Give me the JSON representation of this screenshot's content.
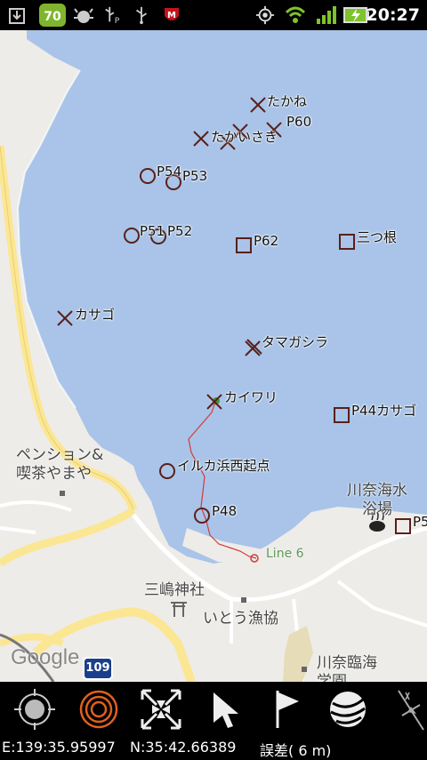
{
  "status_bar": {
    "time": "20:27",
    "badge_count": "70",
    "icons": [
      "download-icon",
      "android-badge-icon",
      "bug-icon",
      "usb-p-icon",
      "usb-icon",
      "mcafee-icon",
      "gps-icon",
      "wifi-icon",
      "signal-icon",
      "battery-charging-icon"
    ]
  },
  "map": {
    "markers": [
      {
        "type": "x",
        "label": "たかね"
      },
      {
        "type": "x",
        "label": "たかいさき"
      },
      {
        "type": "x",
        "label": "P60"
      },
      {
        "type": "circle",
        "label": "P54"
      },
      {
        "type": "circle",
        "label": "P53"
      },
      {
        "type": "circle",
        "label": "P51"
      },
      {
        "type": "circle",
        "label": "P52"
      },
      {
        "type": "square",
        "label": "P62"
      },
      {
        "type": "square",
        "label": "三つ根"
      },
      {
        "type": "x",
        "label": "カサゴ"
      },
      {
        "type": "x",
        "label": "タマガシラ"
      },
      {
        "type": "x",
        "label": "カイワリ"
      },
      {
        "type": "square",
        "label": "P44カサゴ"
      },
      {
        "type": "circle",
        "label": "イルカ浜西起点"
      },
      {
        "type": "circle",
        "label": "P48"
      },
      {
        "type": "square",
        "label": "P5"
      }
    ],
    "places": {
      "pension_line1": "ペンション&",
      "pension_line2": "喫茶やまや",
      "onsen_line1": "川奈海水",
      "onsen_line2": "浴場",
      "shrine": "三嶋神社",
      "fishery": "いとう漁協",
      "school_line1": "川奈臨海",
      "school_line2": "学園"
    },
    "route_label": "Line 6",
    "road_number": "109",
    "attribution": "Google",
    "colors": {
      "water": "#a9c4e8",
      "land": "#eeece8",
      "road": "#fbe694",
      "marker": "#5a1f1a",
      "route": "#d43a3a"
    }
  },
  "toolbar": {
    "buttons": [
      "my-location-button",
      "compass-rings-button",
      "fit-bounds-button",
      "navigate-arrow-button",
      "flag-waypoint-button",
      "globe-button",
      "north-compass-button"
    ]
  },
  "coord_bar": {
    "east": "E:139:35.95997",
    "north": "N:35:42.66389",
    "accuracy": "誤差( 6 m)"
  }
}
